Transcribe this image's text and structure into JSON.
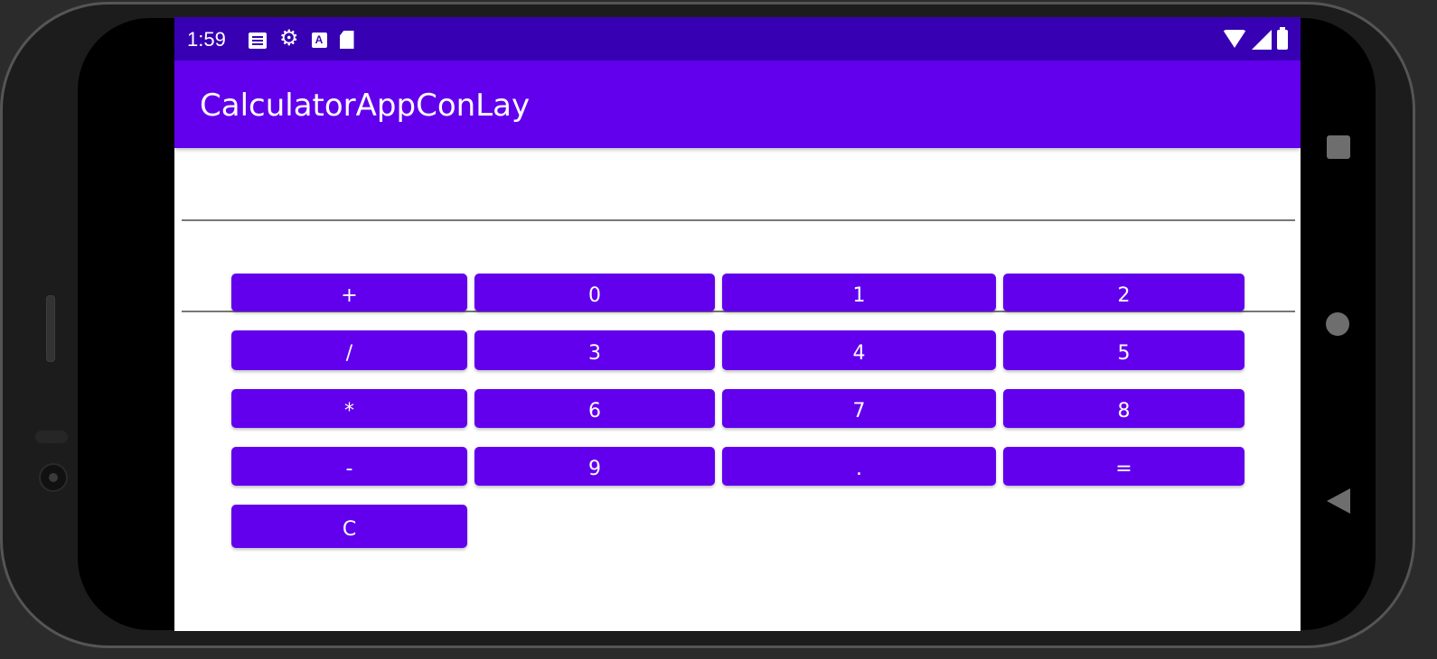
{
  "status_bar": {
    "time": "1:59",
    "left_icons": [
      "news-icon",
      "settings-gear-icon",
      "a-box-icon",
      "sd-card-icon"
    ],
    "right_icons": [
      "wifi-icon",
      "cell-signal-icon",
      "battery-icon"
    ]
  },
  "app_bar": {
    "title": "CalculatorAppConLay"
  },
  "buttons": {
    "row1": [
      "+",
      "0",
      "1",
      "2"
    ],
    "row2": [
      "/",
      "3",
      "4",
      "5"
    ],
    "row3": [
      "*",
      "6",
      "7",
      "8"
    ],
    "row4": [
      "-",
      "9",
      ".",
      "="
    ],
    "row5": [
      "C"
    ]
  },
  "colors": {
    "status_bar": "#3700b3",
    "primary": "#6200ee",
    "button_text": "#ffffff",
    "background": "#ffffff"
  },
  "device_nav": [
    "overview-square-icon",
    "home-circle-icon",
    "back-triangle-icon"
  ]
}
